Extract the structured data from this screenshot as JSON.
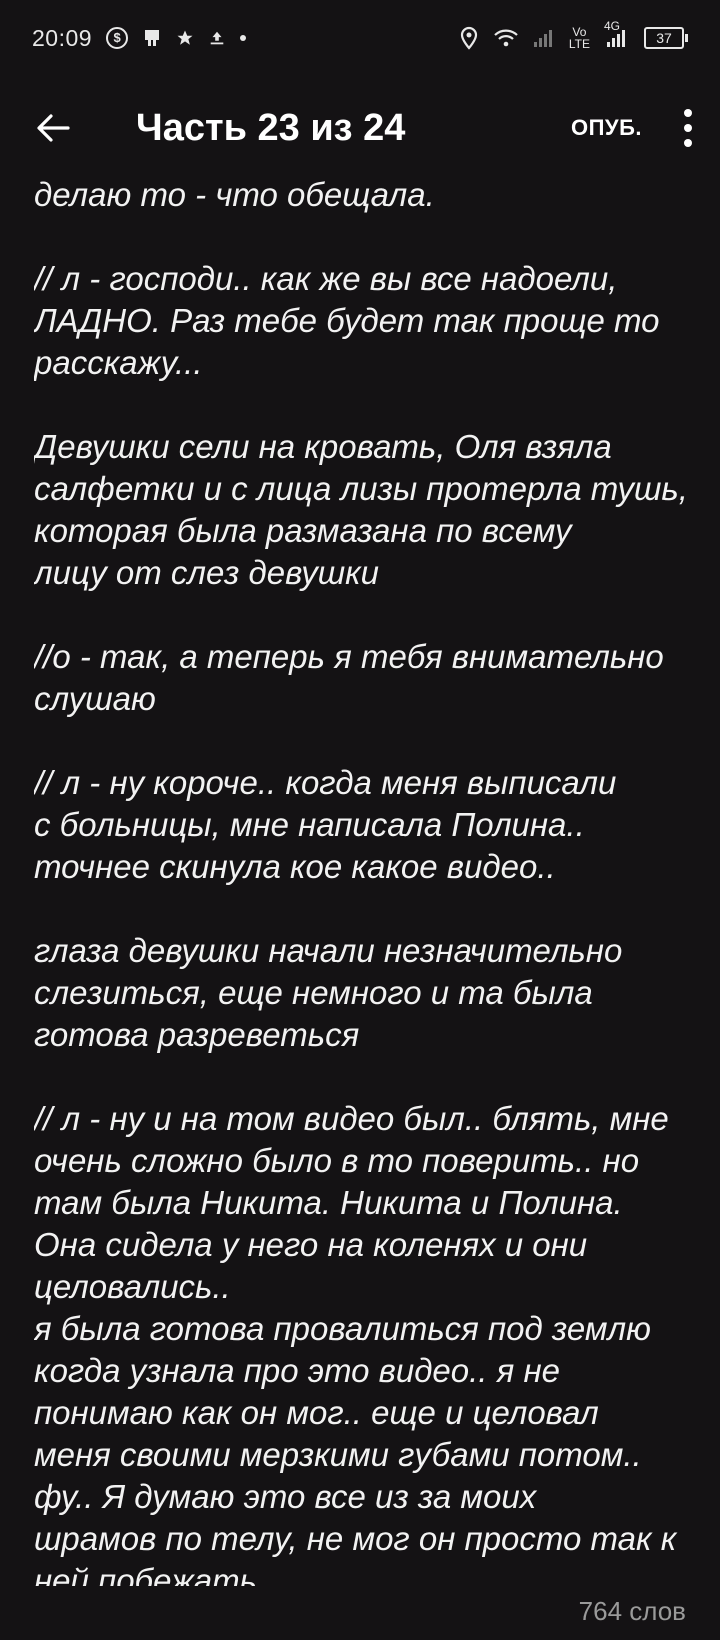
{
  "status_bar": {
    "time": "20:09",
    "battery": "37",
    "network_4g": "4G",
    "volte_top": "Vo",
    "volte_bottom": "LTE"
  },
  "app_bar": {
    "title": "Часть 23 из 24",
    "unpublish_label": "ОПУБ."
  },
  "content": {
    "paragraphs": [
      "делаю то - что обещала.",
      "// л - господи.. как же вы все надоели,\nЛАДНО. Раз тебе будет так проще то\nрасскажу...",
      "Девушки сели на кровать, Оля взяла\nсалфетки и с лица лизы протерла тушь,\nкоторая была размазана по всему\nлицу от слез девушки",
      "//о - так, а теперь я тебя внимательно\nслушаю",
      "// л - ну короче.. когда меня выписали\nс больницы, мне написала Полина..\nточнее скинула кое какое видео..",
      "глаза девушки начали незначительно\nслезиться, еще немного и та была\nготова разреветься",
      "// л - ну и на том видео был.. блять, мне\nочень сложно было в то поверить.. но\nтам была Никита. Никита и Полина.\nОна сидела у него на коленях и они\nцеловались..\nя была готова провалиться под землю\nкогда узнала про это видео.. я не\nпонимаю как он мог.. еще и целовал\nменя своими мерзкими губами потом..\nфу.. Я думаю это все из за моих\nшрамов по телу, не мог он просто так к\nней побежать"
    ]
  },
  "footer": {
    "word_count": "764 слов"
  },
  "colors": {
    "background": "#141214",
    "text": "#f2f2f2",
    "muted": "#9a9a9a"
  }
}
